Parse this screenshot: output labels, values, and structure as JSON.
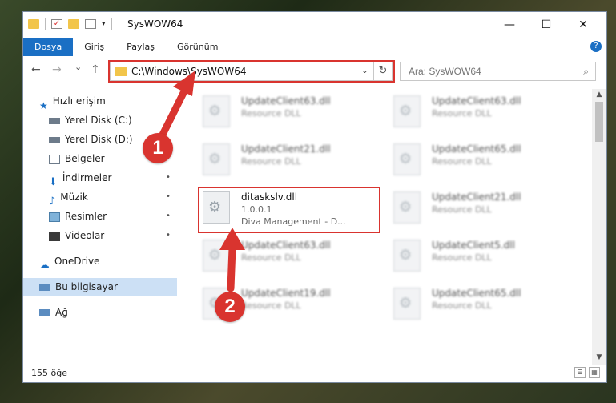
{
  "window": {
    "title": "SysWOW64",
    "minimize_icon": "minimize-icon",
    "maximize_icon": "maximize-icon",
    "close_icon": "close-icon",
    "minimize_glyph": "—",
    "maximize_glyph": "☐",
    "close_glyph": "✕"
  },
  "ribbon": {
    "tabs": [
      "Dosya",
      "Giriş",
      "Paylaş",
      "Görünüm"
    ],
    "active_tab": "Dosya",
    "help_glyph": "?"
  },
  "address": {
    "path": "C:\\Windows\\SysWOW64",
    "dropdown_glyph": "⌄",
    "refresh_glyph": "↻"
  },
  "search": {
    "placeholder": "Ara: SysWOW64",
    "icon": "search-icon",
    "glyph": "⌕"
  },
  "nav_glyphs": {
    "back": "←",
    "forward": "→",
    "recent": "⌄",
    "up": "↑"
  },
  "sidebar": {
    "quick_access": "Hızlı erişim",
    "items": [
      {
        "label": "Yerel Disk (C:)",
        "icon": "drive-icon"
      },
      {
        "label": "Yerel Disk (D:)",
        "icon": "drive-icon"
      },
      {
        "label": "Belgeler",
        "icon": "documents-icon"
      },
      {
        "label": "İndirmeler",
        "icon": "downloads-icon"
      },
      {
        "label": "Müzik",
        "icon": "music-icon"
      },
      {
        "label": "Resimler",
        "icon": "pictures-icon"
      },
      {
        "label": "Videolar",
        "icon": "videos-icon"
      }
    ],
    "onedrive": "OneDrive",
    "this_pc": "Bu bilgisayar",
    "network": "Ağ",
    "pin_glyph": "📌"
  },
  "files": [
    {
      "name": "UpdateClient63.dll",
      "desc": "Resource DLL",
      "blurred": true
    },
    {
      "name": "UpdateClient63.dll",
      "desc": "Resource DLL",
      "blurred": true
    },
    {
      "name": "UpdateClient21.dll",
      "desc": "Resource DLL",
      "blurred": true
    },
    {
      "name": "UpdateClient65.dll",
      "desc": "Resource DLL",
      "blurred": true
    },
    {
      "name": "ditaskslv.dll",
      "version": "1.0.0.1",
      "desc": "Diva Management - D...",
      "blurred": false
    },
    {
      "name": "UpdateClient21.dll",
      "desc": "Resource DLL",
      "blurred": true
    },
    {
      "name": "UpdateClient63.dll",
      "desc": "Resource DLL",
      "blurred": true
    },
    {
      "name": "UpdateClient5.dll",
      "desc": "Resource DLL",
      "blurred": true
    },
    {
      "name": "UpdateClient19.dll",
      "desc": "Resource DLL",
      "blurred": true
    },
    {
      "name": "UpdateClient65.dll",
      "desc": "Resource DLL",
      "blurred": true
    }
  ],
  "status": {
    "item_count": "155 öğe"
  },
  "view_glyphs": {
    "details": "☰",
    "tiles": "▦"
  },
  "callouts": {
    "one": "1",
    "two": "2"
  },
  "colors": {
    "accent": "#1a6fc4",
    "highlight": "#d9342f",
    "selected": "#cce0f5"
  }
}
